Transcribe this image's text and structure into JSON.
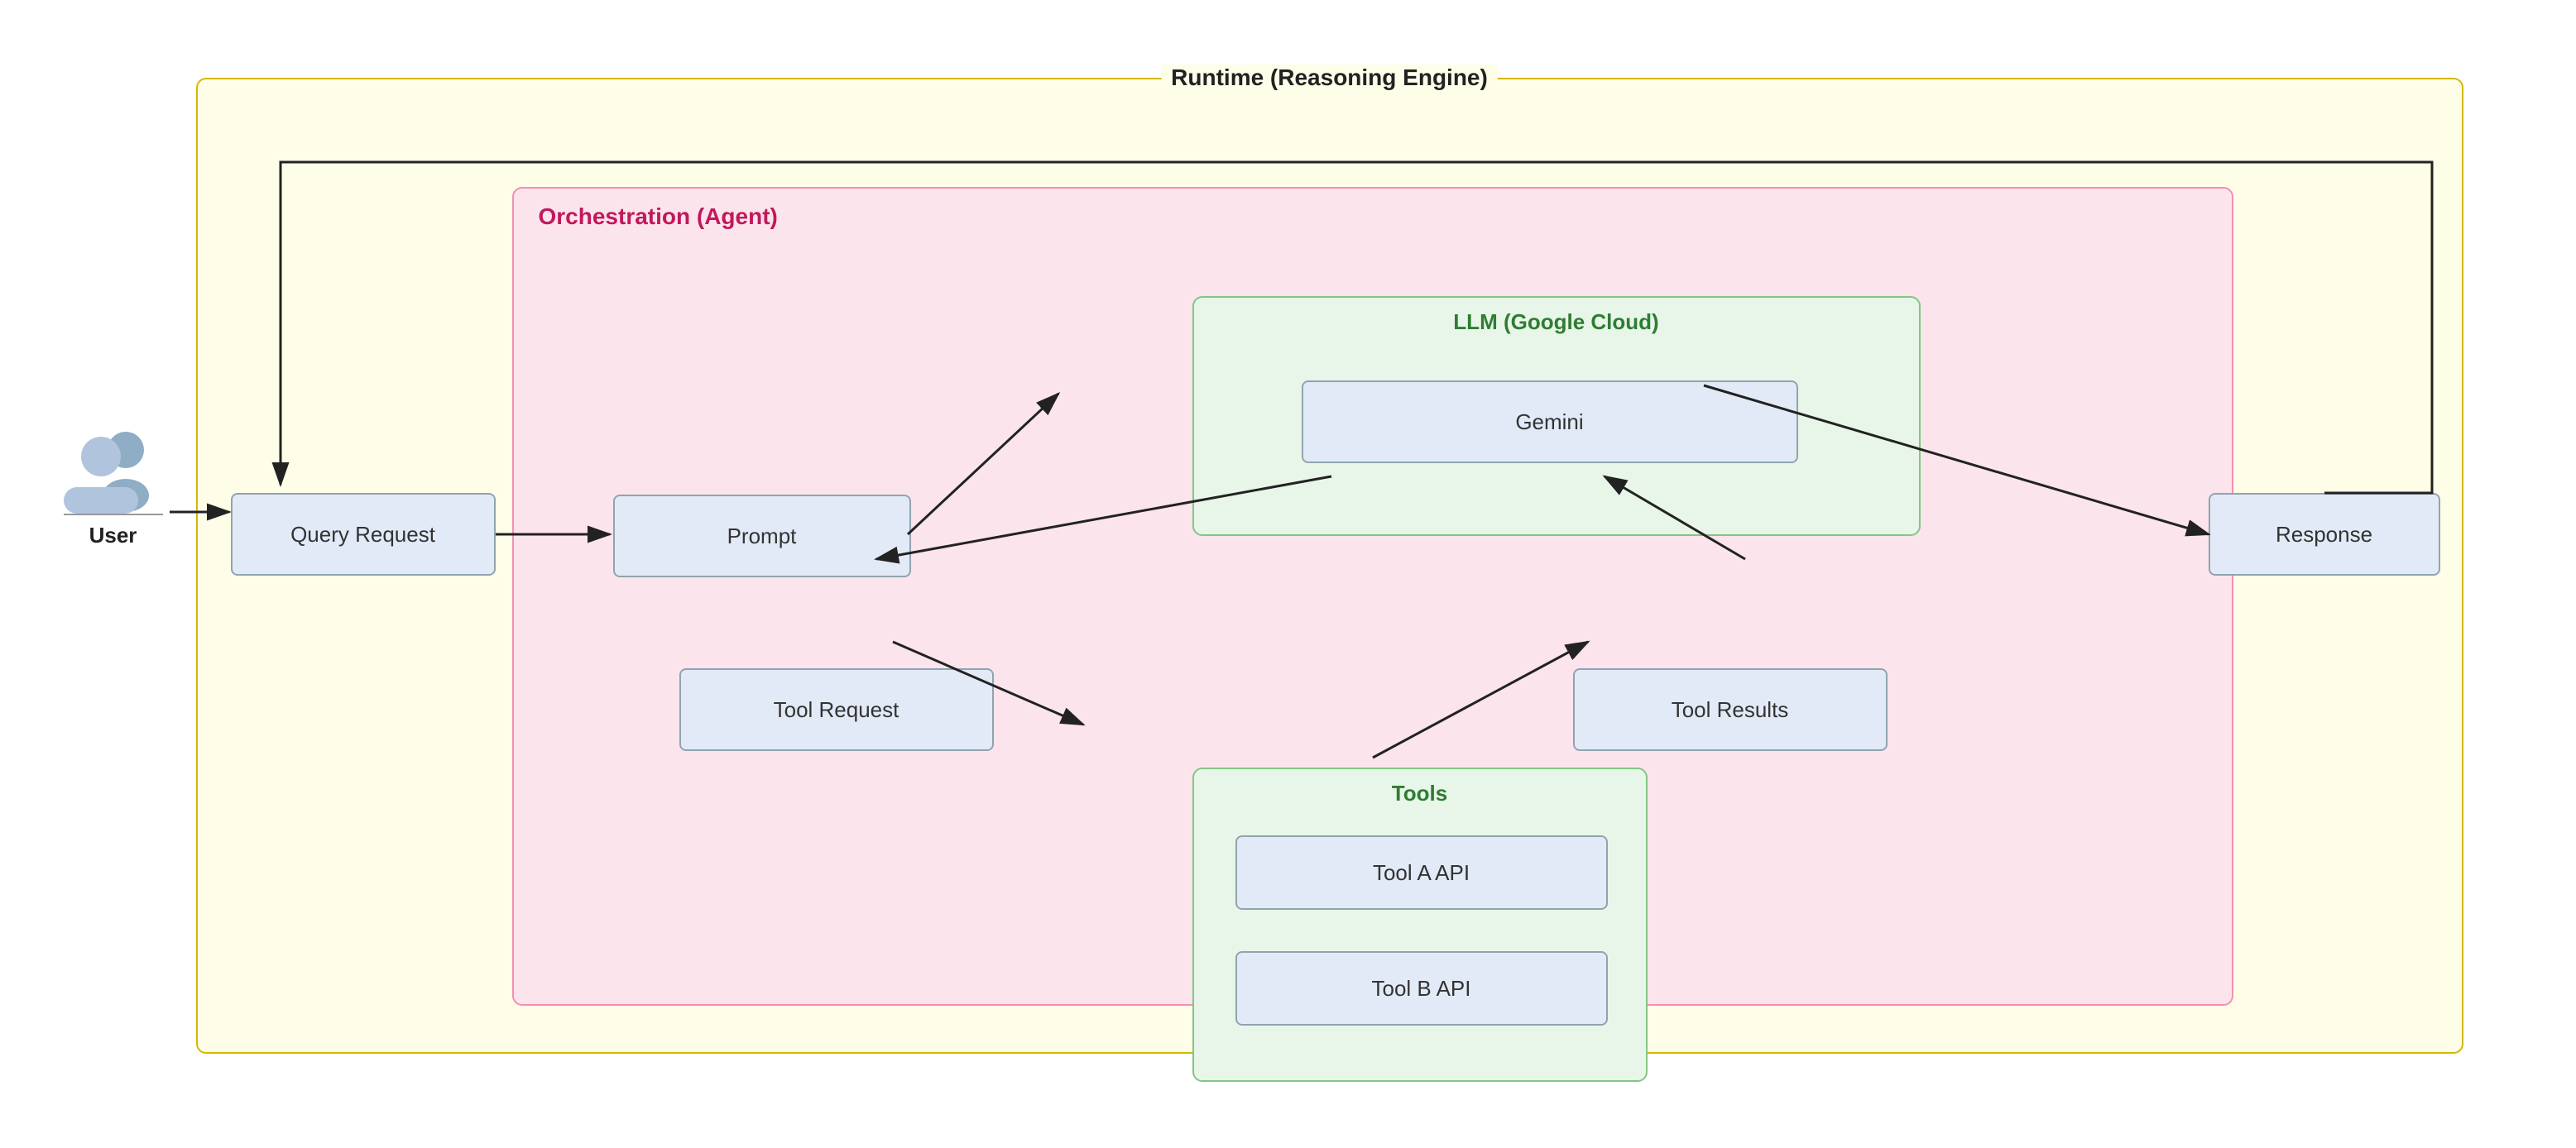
{
  "title": "Runtime (Reasoning Engine)",
  "labels": {
    "runtime": "Runtime (Reasoning Engine)",
    "orchestration": "Orchestration (Agent)",
    "llm": "LLM (Google Cloud)",
    "tools": "Tools",
    "user": "User"
  },
  "nodes": {
    "query_request": "Query Request",
    "prompt": "Prompt",
    "gemini": "Gemini",
    "response": "Response",
    "tool_request": "Tool Request",
    "tool_results": "Tool Results",
    "tool_a": "Tool A API",
    "tool_b": "Tool B API"
  }
}
